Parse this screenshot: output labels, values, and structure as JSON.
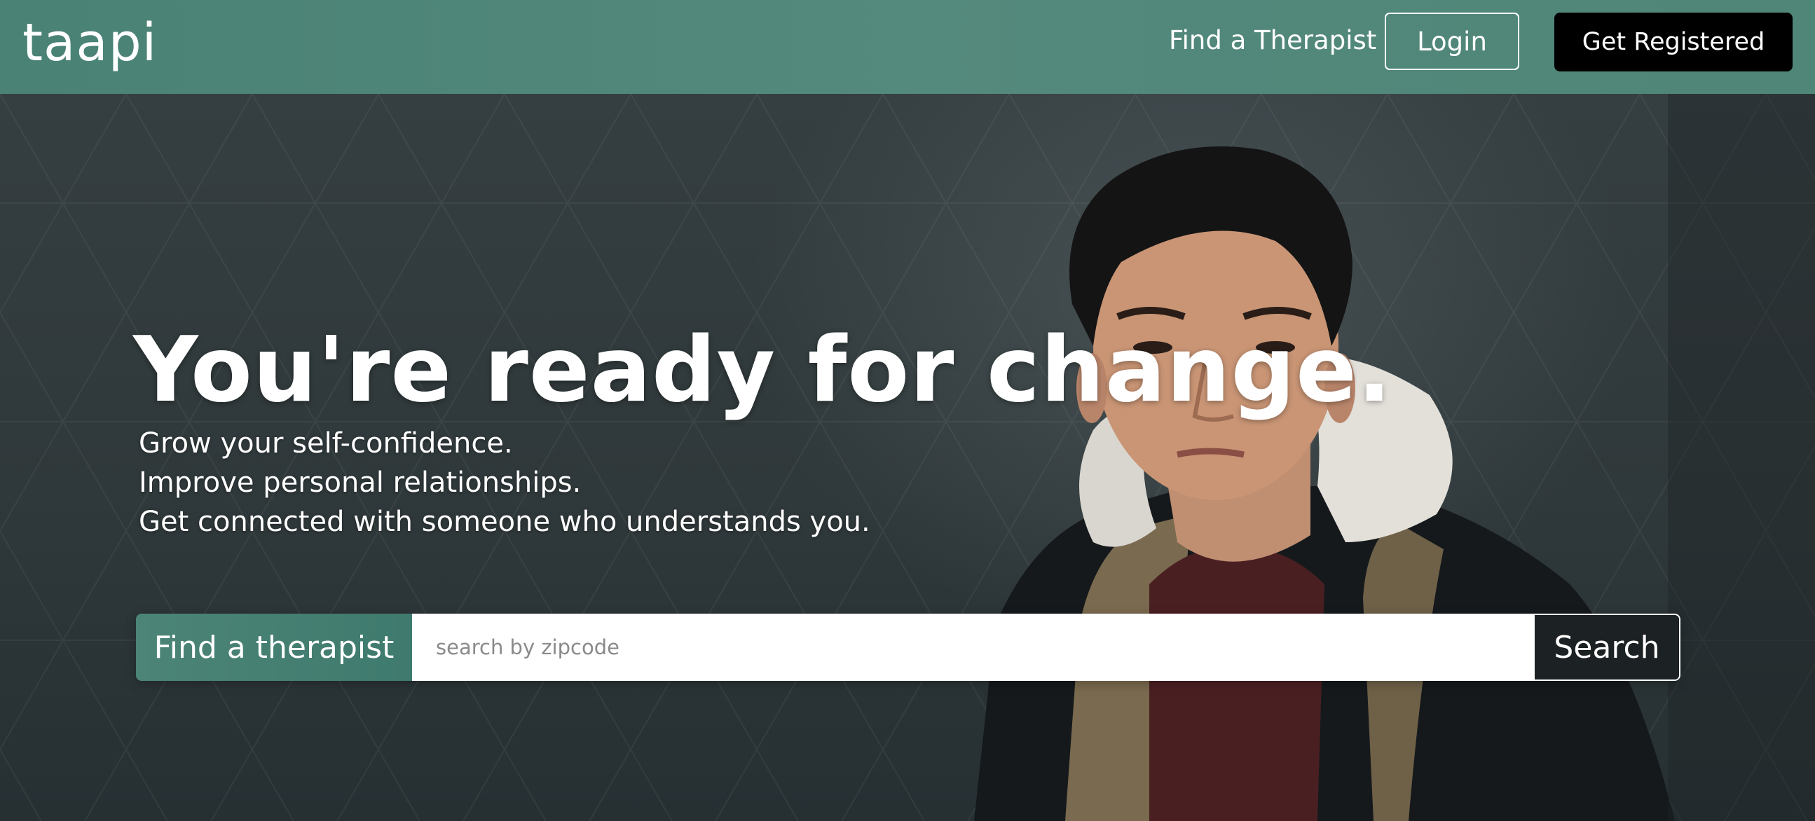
{
  "header": {
    "logo": "taapi",
    "nav_find_therapist": "Find a Therapist",
    "login_label": "Login",
    "register_label": "Get Registered"
  },
  "hero": {
    "headline": "You're ready for change.",
    "lines": [
      "Grow your self-confidence.",
      "Improve personal relationships.",
      "Get connected with someone who understands you."
    ],
    "search": {
      "label": "Find a therapist",
      "placeholder": "search by zipcode",
      "value": "",
      "button_label": "Search"
    }
  },
  "colors": {
    "brand_green": "#54897d",
    "register_button": "#000000",
    "search_button": "#1c2123"
  },
  "icons": []
}
